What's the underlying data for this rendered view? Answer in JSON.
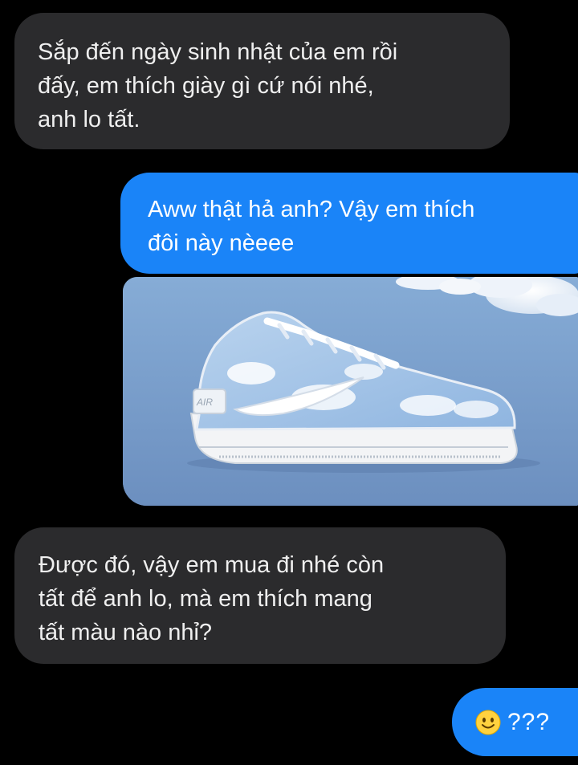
{
  "messages": [
    {
      "sender": "other",
      "lines": [
        "Sắp đến ngày sinh nhật của em rồi",
        "đấy, em thích giày gì cứ nói nhé,",
        "anh lo tất."
      ]
    },
    {
      "sender": "me",
      "lines": [
        "Aww thật hả anh? Vậy em thích",
        "đôi này nèeee"
      ]
    },
    {
      "sender": "other",
      "lines": [
        "Được đó, vậy em mua đi nhé còn",
        "tất để anh lo, mà em thích mang",
        "tất màu nào nhỉ?"
      ]
    },
    {
      "sender": "me",
      "emoji": "smiling-face-emoji",
      "text": "???"
    }
  ],
  "image": {
    "subject": "sneaker-with-cloud-pattern",
    "shoe_text": "AIR"
  },
  "colors": {
    "background": "#000000",
    "incoming_bubble": "#2b2b2d",
    "outgoing_bubble": "#1a84f8",
    "image_sky": "#7fa6d1"
  }
}
